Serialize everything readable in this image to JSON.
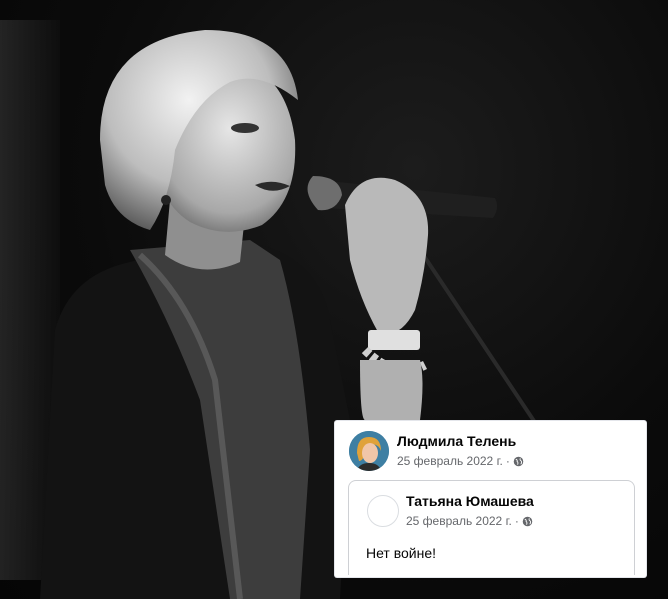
{
  "post": {
    "author_name": "Людмила Телень",
    "date": "25 февраль 2022 г.",
    "separator": "·",
    "privacy_icon": "globe-icon"
  },
  "shared_post": {
    "author_name": "Татьяна Юмашева",
    "date": "25 февраль 2022 г.",
    "separator": "·",
    "privacy_icon": "globe-icon",
    "text": "Нет войне!"
  },
  "colors": {
    "text_primary": "#050505",
    "text_secondary": "#65676b",
    "card_background": "#ffffff",
    "border": "#ced0d4"
  }
}
